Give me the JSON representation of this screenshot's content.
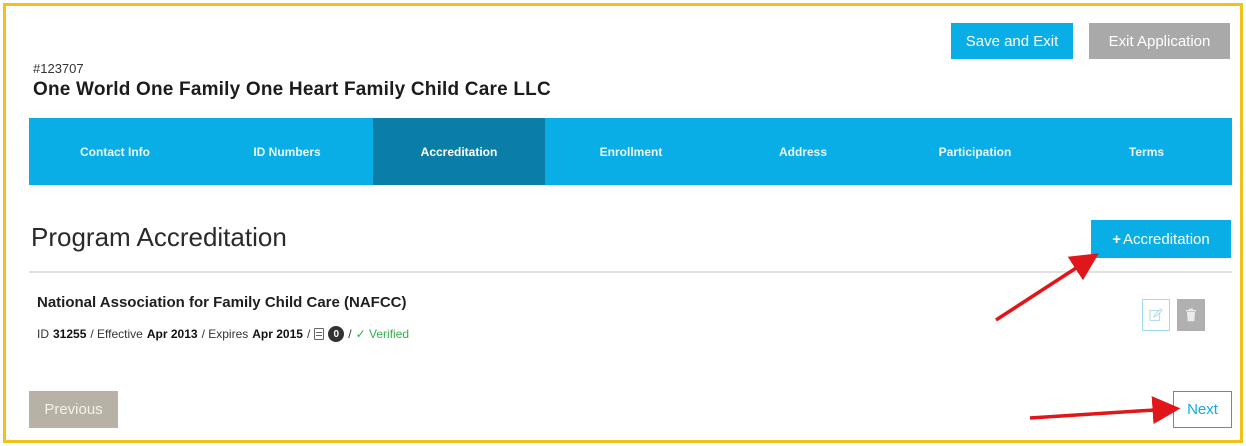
{
  "header": {
    "save_exit_label": "Save and Exit",
    "exit_application_label": "Exit Application",
    "application_id": "#123707",
    "organization_name": "One World One Family One Heart Family Child Care LLC"
  },
  "tabs": [
    {
      "label": "Contact Info",
      "active": false
    },
    {
      "label": "ID Numbers",
      "active": false
    },
    {
      "label": "Accreditation",
      "active": true
    },
    {
      "label": "Enrollment",
      "active": false
    },
    {
      "label": "Address",
      "active": false
    },
    {
      "label": "Participation",
      "active": false
    },
    {
      "label": "Terms",
      "active": false
    }
  ],
  "section": {
    "title": "Program Accreditation",
    "add_button_label": "Accreditation",
    "add_button_icon": "plus-icon"
  },
  "accreditation": {
    "name": "National Association for Family Child Care (NAFCC)",
    "id_label": "ID",
    "id_value": "31255",
    "effective_label": "/ Effective",
    "effective_value": "Apr 2013",
    "expires_label": "/ Expires",
    "expires_value": "Apr 2015",
    "document_icon": "document-icon",
    "document_count": "0",
    "verified_label": "✓ Verified",
    "edit_icon": "edit-icon",
    "delete_icon": "trash-icon"
  },
  "footer": {
    "previous_label": "Previous",
    "next_label": "Next"
  },
  "colors": {
    "primary": "#0aaee6",
    "tab_active": "#0b7ea8",
    "frame_border": "#f2c21b",
    "verified": "#2fb14a",
    "annotation_arrow": "#e0161b",
    "disabled_button": "#b8b1a6"
  }
}
